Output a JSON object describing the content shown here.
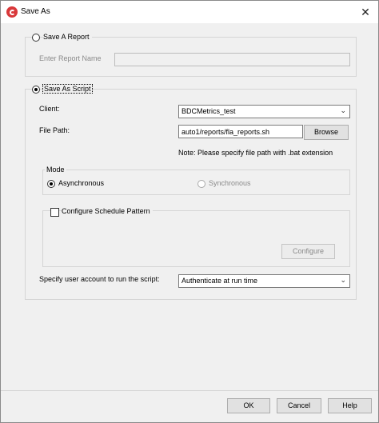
{
  "window": {
    "title": "Save As",
    "close_glyph": "✕"
  },
  "report": {
    "radio_label": "Save A Report",
    "name_label": "Enter Report Name",
    "name_value": ""
  },
  "script": {
    "radio_label": "Save As Script",
    "client_label": "Client:",
    "client_value": "BDCMetrics_test",
    "file_path_label": "File Path:",
    "file_path_value": "auto1/reports/fla_reports.sh",
    "browse_label": "Browse",
    "note": "Note: Please specify file path with .bat extension",
    "mode": {
      "label": "Mode",
      "async_label": "Asynchronous",
      "sync_label": "Synchronous",
      "selected": "Asynchronous"
    },
    "schedule": {
      "checkbox_label": "Configure Schedule Pattern",
      "checked": false,
      "configure_label": "Configure"
    },
    "account_label": "Specify user account to run the script:",
    "account_value": "Authenticate at run time"
  },
  "footer": {
    "ok_label": "OK",
    "cancel_label": "Cancel",
    "help_label": "Help"
  }
}
